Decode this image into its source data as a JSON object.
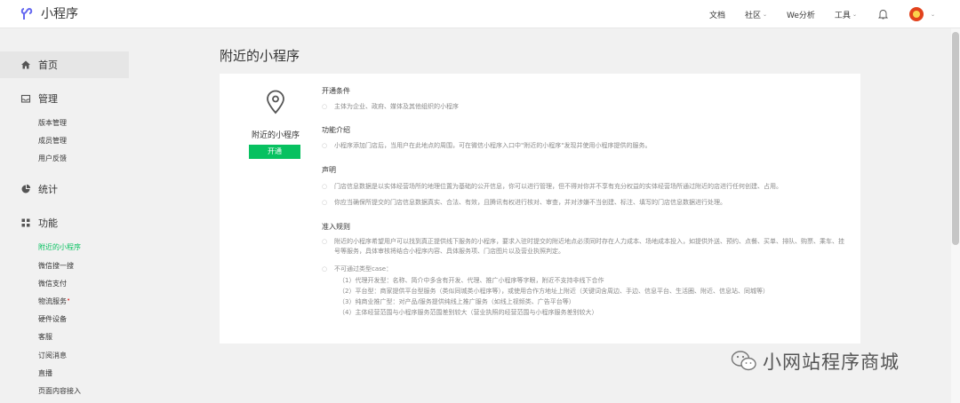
{
  "header": {
    "logo_text": "小程序",
    "nav": [
      {
        "label": "文档",
        "caret": false
      },
      {
        "label": "社区",
        "caret": true
      },
      {
        "label": "We分析",
        "caret": false
      },
      {
        "label": "工具",
        "caret": true
      }
    ],
    "caret": "⌄"
  },
  "sidebar": {
    "home": "首页",
    "groups": [
      {
        "title": "管理",
        "items": [
          "版本管理",
          "成员管理",
          "用户反馈"
        ]
      },
      {
        "title": "统计",
        "items": []
      },
      {
        "title": "功能",
        "items": [
          "附近的小程序",
          "微信搜一搜",
          "微信支付",
          "物流服务",
          "硬件设备",
          "客服",
          "订阅消息",
          "直播",
          "页面内容接入"
        ]
      }
    ],
    "badge": "•",
    "active_item": "附近的小程序"
  },
  "main": {
    "page_title": "附近的小程序",
    "card": {
      "name": "附近的小程序",
      "button": "开通",
      "sections": [
        {
          "title": "开通条件",
          "items": [
            "主体为企业、政府、媒体及其他组织的小程序"
          ]
        },
        {
          "title": "功能介绍",
          "items": [
            "小程序添加门店后，当用户在此地点的周围，可在微信小程序入口中\"附近的小程序\"发现并使用小程序提供的服务。"
          ]
        },
        {
          "title": "声明",
          "items": [
            "门店信息数据是以实体经营场所的地理位置为基础的公开信息，你可以进行管理，但不得对你并不享有充分权益的实体经营场所通过附近的店进行任何创建、占用。",
            "你应当确保所提交的门店信息数据真实、合法、有效，且腾讯有权进行核对、审查，并对涉嫌不当创建、标注、填写的门店信息数据进行处理。"
          ]
        },
        {
          "title": "准入规则",
          "items": [
            "附近的小程序希望用户可以找到真正提供线下服务的小程序，要求入驻时提交的附近地点必须同时存在人力成本、场地成本投入，如提供外送、预约、点餐、买单、排队、购票、乘车、挂号等服务，具体审核将结合小程序内容、具体服务项、门店图片以及营业执照判定。",
            "不可通过类型case："
          ],
          "sub_items": [
            "（1）代理开发型：名称、简介中多含有开发、代理、推广小程序等字眼，附近不支持非线下合作",
            "（2）平台型：商家提供平台型服务（类似同城类小程序等），或使用合作方地址上附近（关键词含周边、手边、信息平台、生活圈、附近、信息站、同城等）",
            "（3）纯商业推广型：对产品/服务提供纯线上推广服务（如线上视频类、广告平台等）",
            "（4）主体经营范围与小程序服务范围差别较大（营业执照的经营范围与小程序服务差别较大）"
          ]
        }
      ]
    }
  },
  "watermark": "小网站程序商城",
  "bullet": "○",
  "colors": {
    "accent": "#07c160",
    "badge": "#e64340"
  }
}
